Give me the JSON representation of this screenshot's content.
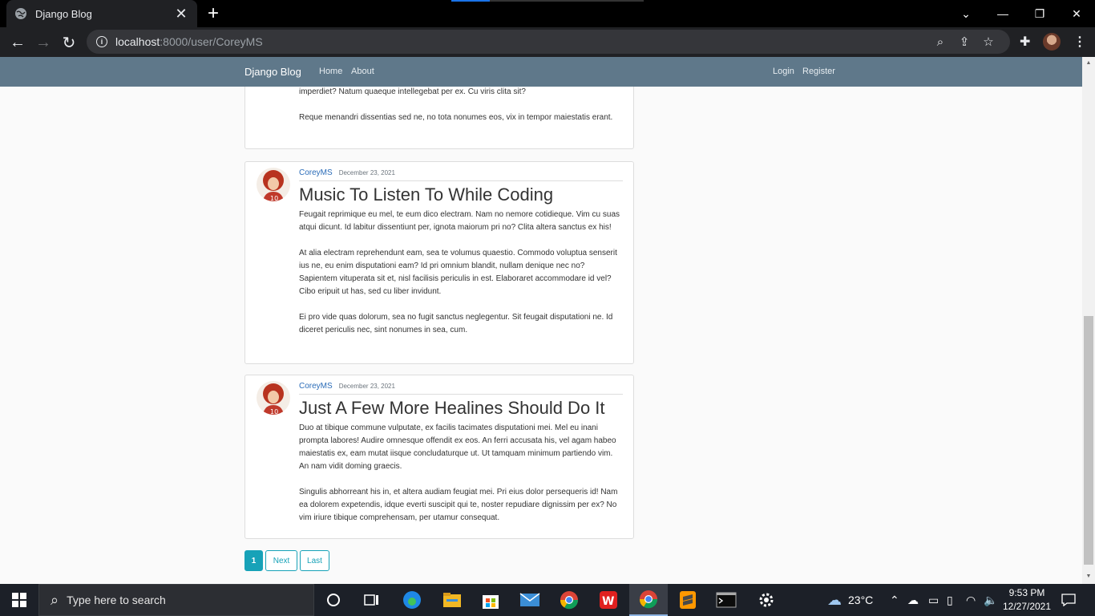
{
  "browser": {
    "tab_title": "Django Blog",
    "url_host": "localhost",
    "url_rest": ":8000/user/CoreyMS"
  },
  "site": {
    "brand": "Django Blog",
    "nav_left": [
      "Home",
      "About"
    ],
    "nav_right": [
      "Login",
      "Register"
    ]
  },
  "posts": [
    {
      "paragraphs": [
        "imperdiet? Natum quaeque intellegebat per ex. Cu viris clita sit?",
        "Reque menandri dissentias sed ne, no tota nonumes eos, vix in tempor maiestatis erant."
      ]
    },
    {
      "author": "CoreyMS",
      "date": "December 23, 2021",
      "title": "Music To Listen To While Coding",
      "paragraphs": [
        "Feugait reprimique eu mel, te eum dico electram. Nam no nemore cotidieque. Vim cu suas atqui dicunt. Id labitur dissentiunt per, ignota maiorum pri no? Clita altera sanctus ex his!",
        "At alia electram reprehendunt eam, sea te volumus quaestio. Commodo voluptua senserit ius ne, eu enim disputationi eam? Id pri omnium blandit, nullam denique nec no? Sapientem vituperata sit et, nisl facilisis periculis in est. Elaboraret accommodare id vel? Cibo eripuit ut has, sed cu liber invidunt.",
        "Ei pro vide quas dolorum, sea no fugit sanctus neglegentur. Sit feugait disputationi ne. Id diceret periculis nec, sint nonumes in sea, cum."
      ]
    },
    {
      "author": "CoreyMS",
      "date": "December 23, 2021",
      "title": "Just A Few More Healines Should Do It",
      "paragraphs": [
        "Duo at tibique commune vulputate, ex facilis tacimates disputationi mei. Mel eu inani prompta labores! Audire omnesque offendit ex eos. An ferri accusata his, vel agam habeo maiestatis ex, eam mutat iisque concludaturque ut. Ut tamquam minimum partiendo vim. An nam vidit doming graecis.",
        "Singulis abhorreant his in, et altera audiam feugiat mei. Pri eius dolor persequeris id! Nam ea dolorem expetendis, idque everti suscipit qui te, noster repudiare dignissim per ex? No vim iriure tibique comprehensam, per utamur consequat."
      ]
    }
  ],
  "pagination": [
    "1",
    "Next",
    "Last"
  ],
  "taskbar": {
    "search_placeholder": "Type here to search",
    "temperature": "23°C",
    "time": "9:53 PM",
    "date": "12/27/2021"
  },
  "colors": {
    "navbar": "#5f788a",
    "link": "#2b6cb8",
    "pager": "#17a2b8"
  }
}
